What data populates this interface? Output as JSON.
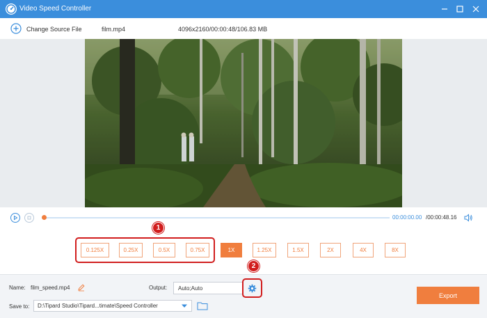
{
  "window": {
    "title": "Video Speed Controller"
  },
  "source": {
    "change_label": "Change Source File",
    "file_name": "film.mp4",
    "file_meta": "4096x2160/00:00:48/106.83 MB"
  },
  "playback": {
    "current_time": "00:00:00.00",
    "total_time": "/00:00:48.16",
    "progress": 0
  },
  "speeds": {
    "options": [
      "0.125X",
      "0.25X",
      "0.5X",
      "0.75X",
      "1X",
      "1.25X",
      "1.5X",
      "2X",
      "4X",
      "8X"
    ],
    "selected": "1X",
    "annotation_1": "1",
    "annotation_2": "2"
  },
  "output": {
    "name_label": "Name:",
    "name_value": "film_speed.mp4",
    "output_label": "Output:",
    "output_value": "Auto;Auto",
    "save_label": "Save to:",
    "save_path": "D:\\Tipard Studio\\Tipard...timate\\Speed Controller",
    "export_label": "Export"
  },
  "colors": {
    "titlebar": "#3b8edc",
    "accent": "#f07e3e",
    "annotation": "#d11d1d"
  },
  "icons": [
    "app-logo-icon",
    "minimize-icon",
    "maximize-icon",
    "close-icon",
    "add-icon",
    "play-icon",
    "stop-icon",
    "volume-icon",
    "edit-icon",
    "gear-icon",
    "chevron-down-icon",
    "folder-icon"
  ]
}
